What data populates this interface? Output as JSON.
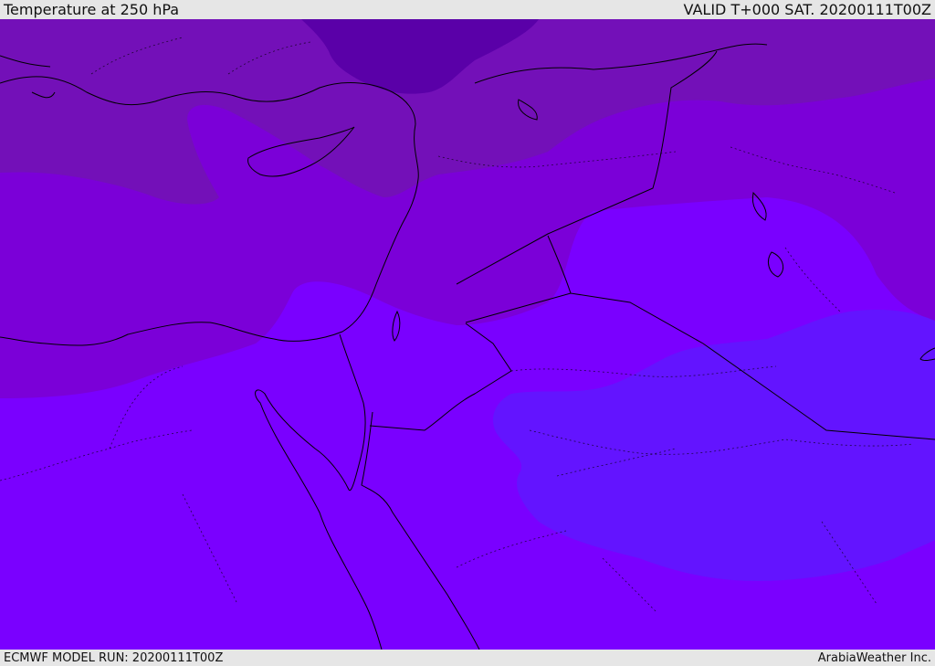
{
  "header": {
    "title": "Temperature at 250 hPa",
    "valid": "VALID T+000 SAT. 20200111T00Z"
  },
  "footer": {
    "model_run": "ECMWF MODEL RUN: 20200111T00Z",
    "credit": "ArabiaWeather Inc."
  },
  "colors": {
    "band_darkest": "#5a00a8",
    "band_dark": "#7310b8",
    "band_mid": "#7b00d8",
    "band_light": "#7a00ff",
    "band_blue": "#6314ff",
    "coastline": "#000000"
  }
}
